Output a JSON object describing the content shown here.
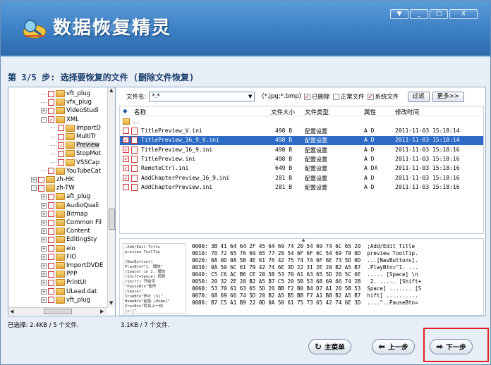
{
  "app": {
    "title": "数据恢复精灵",
    "window_buttons": [
      "▼",
      "_",
      "□",
      "X"
    ]
  },
  "step_title": "第 3/5 步: 选择要恢复的文件 (删除文件恢复)",
  "tree": {
    "items": [
      {
        "label": "vft_plug",
        "indent": 4,
        "exp": "",
        "checked": false
      },
      {
        "label": "vfx_plug",
        "indent": 4,
        "exp": "",
        "checked": false
      },
      {
        "label": "VideoStudi",
        "indent": 4,
        "exp": "+",
        "checked": false
      },
      {
        "label": "XML",
        "indent": 4,
        "exp": "-",
        "checked": true
      },
      {
        "label": "ImportD",
        "indent": 5,
        "exp": "",
        "checked": false
      },
      {
        "label": "MultiTr",
        "indent": 5,
        "exp": "",
        "checked": false
      },
      {
        "label": "Preview",
        "indent": 5,
        "exp": "",
        "checked": true,
        "selected": true
      },
      {
        "label": "StopMot",
        "indent": 5,
        "exp": "",
        "checked": false
      },
      {
        "label": "VSSCap",
        "indent": 5,
        "exp": "",
        "checked": false
      },
      {
        "label": "YouTubeCat",
        "indent": 4,
        "exp": "",
        "checked": false
      },
      {
        "label": "zh-HK",
        "indent": 3,
        "exp": "+",
        "checked": false
      },
      {
        "label": "zh-TW",
        "indent": 3,
        "exp": "-",
        "checked": false
      },
      {
        "label": "aft_plug",
        "indent": 4,
        "exp": "+",
        "checked": false
      },
      {
        "label": "AudioQuali",
        "indent": 4,
        "exp": "+",
        "checked": false
      },
      {
        "label": "Bitmap",
        "indent": 4,
        "exp": "+",
        "checked": false
      },
      {
        "label": "Common Fil",
        "indent": 4,
        "exp": "+",
        "checked": false
      },
      {
        "label": "Content",
        "indent": 4,
        "exp": "+",
        "checked": false
      },
      {
        "label": "EditingSty",
        "indent": 4,
        "exp": "+",
        "checked": false
      },
      {
        "label": "eio",
        "indent": 4,
        "exp": "+",
        "checked": false
      },
      {
        "label": "FIO",
        "indent": 4,
        "exp": "+",
        "checked": false
      },
      {
        "label": "ImportDVDE",
        "indent": 4,
        "exp": "+",
        "checked": false
      },
      {
        "label": "PPP",
        "indent": 4,
        "exp": "+",
        "checked": false
      },
      {
        "label": "PrintUI",
        "indent": 4,
        "exp": "+",
        "checked": false
      },
      {
        "label": "ULead.dat",
        "indent": 4,
        "exp": "+",
        "checked": false
      },
      {
        "label": "vft_plug",
        "indent": 4,
        "exp": "+",
        "checked": false
      }
    ]
  },
  "filter": {
    "name_label": "文件名:",
    "name_value": "*.*",
    "ext_hint": "(*.jpg;*.bmp)",
    "deleted_label": "已删除",
    "deleted_checked": true,
    "normal_label": "正常文件",
    "normal_checked": false,
    "system_label": "系统文件",
    "system_checked": true,
    "filter_button": "过滤",
    "more_button": "更多>>"
  },
  "list": {
    "headers": {
      "name": "名称",
      "size": "文件大小",
      "type": "文件类型",
      "attr": "属性",
      "mtime": "修改时间"
    },
    "parent_row": "..",
    "rows": [
      {
        "name": "TitlePreview_V.ini",
        "size": "498 B",
        "type": "配置设置",
        "attr": "A D",
        "mtime": "2011-11-03 15:18:14",
        "checked": false,
        "selected": false
      },
      {
        "name": "TitlePreview_16_9_V.ini",
        "size": "498 B",
        "type": "配置设置",
        "attr": "A D",
        "mtime": "2011-11-03 15:18:14",
        "checked": true,
        "selected": true
      },
      {
        "name": "TitlePreview_16_9.ini",
        "size": "498 B",
        "type": "配置设置",
        "attr": "A D",
        "mtime": "2011-11-03 15:18:16",
        "checked": true,
        "selected": false
      },
      {
        "name": "TitlePreview.ini",
        "size": "498 B",
        "type": "配置设置",
        "attr": "A D",
        "mtime": "2011-11-03 15:18:16",
        "checked": true,
        "selected": false
      },
      {
        "name": "RemoteCtrl.ini",
        "size": "649 B",
        "type": "配置设置",
        "attr": "A DX",
        "mtime": "2011-11-03 15:18:16",
        "checked": true,
        "selected": false
      },
      {
        "name": "AddChapterPreview_16_9.ini",
        "size": "281 B",
        "type": "配置设置",
        "attr": "A D",
        "mtime": "2011-11-03 15:18:16",
        "checked": true,
        "selected": false
      },
      {
        "name": "AddChapterPreview.ini",
        "size": "281 B",
        "type": "配置设置",
        "attr": "A D",
        "mtime": "2011-11-03 15:18:16",
        "checked": false,
        "selected": false
      }
    ]
  },
  "hex": {
    "thumb_text": ";Add/Edit Title\npreview ToolTip\n\n[NavButtons]\nPlayBtn=\"1. 播放\"\n[Space] in 2. 播放\n[Shift+Space] 视频\n[Shift] 开始寺\n\"PauseBtn\"暂停\n[Space]\"\nStopBtn\"停止 [S]\"\nHomeBtn\"起始 [Home]\"\nPrevBtn\"转到上一帧\n[<-]\"",
    "lines": [
      "0000: 3B 41 64 64 2F 45 64 69 74 20 54 69 74 6C 65 20  ;Add/Edit Title ",
      "0010: 70 72 65 76 69 65 77 20 54 6F 6F 6C 54 69 70 0D  preview ToolTip.",
      "0020: 0A 0D 0A 5B 4E 61 76 42 75 74 74 6F 6E 73 5D 0D  ...[NavButtons].",
      "0030: 0A 50 6C 61 79 42 74 6E 3D 22 31 2E 20 B2 A5 B7  .PlayBtn=\"1. ...",
      "0040: C5 C6 AC B6 CE 20 5B 53 70 61 63 65 5D 20 5C 6E  ..... [Space] \\n",
      "0050: 20 32 2E 20 B2 A5 B7 C5 20 5B 53 68 69 66 74 2B   2. ..... [Shift+",
      "0060: 53 70 61 63 65 5D 20 BB F2 B0 B4 D7 A1 20 5B 53  Space] ....... [S",
      "0070: 68 69 66 74 5D 20 B2 A5 B5 BB F7 A1 B8 B2 A5 B7  hift] ..........",
      "0080: B7 C5 A1 B9 22 0D 0A 50 61 75 73 65 42 74 6E 3D  ....\"..PauseBtn="
    ]
  },
  "status": {
    "left": "已选择: 2.4KB / 5 个文件.",
    "right": "3.1KB / 7 个文件."
  },
  "nav": {
    "main_menu": "主菜单",
    "prev": "上一步",
    "next": "下一步"
  },
  "colors": {
    "banner": "#3c7fc4",
    "selection": "#2e6bc6",
    "highlight": "#e02020"
  }
}
